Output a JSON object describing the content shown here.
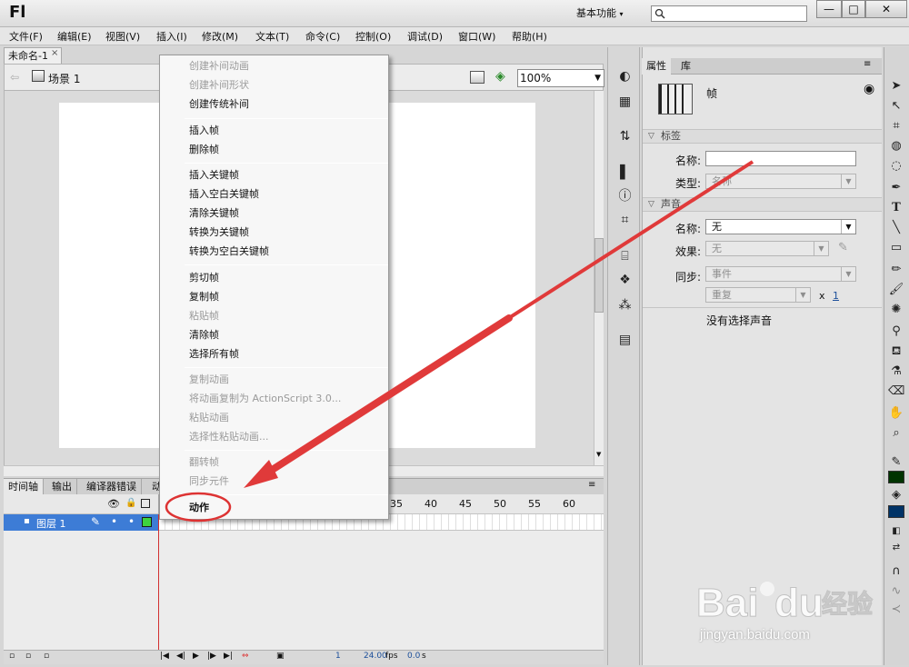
{
  "app": {
    "logo": "Fl",
    "workspace": "基本功能",
    "search_placeholder": ""
  },
  "window_controls": {
    "minimize": "—",
    "maximize": "□",
    "close": "✕"
  },
  "menubar": [
    "文件(F)",
    "编辑(E)",
    "视图(V)",
    "插入(I)",
    "修改(M)",
    "文本(T)",
    "命令(C)",
    "控制(O)",
    "调试(D)",
    "窗口(W)",
    "帮助(H)"
  ],
  "document": {
    "tab": "未命名-1",
    "tab_close": "×",
    "scene": "场景 1",
    "zoom": "100%"
  },
  "context_menu": {
    "items": [
      {
        "label": "创建补间动画",
        "enabled": false
      },
      {
        "label": "创建补间形状",
        "enabled": false
      },
      {
        "label": "创建传统补间",
        "enabled": true
      },
      {
        "label": "插入帧",
        "enabled": true
      },
      {
        "label": "删除帧",
        "enabled": true
      },
      {
        "label": "插入关键帧",
        "enabled": true
      },
      {
        "label": "插入空白关键帧",
        "enabled": true
      },
      {
        "label": "清除关键帧",
        "enabled": true
      },
      {
        "label": "转换为关键帧",
        "enabled": true
      },
      {
        "label": "转换为空白关键帧",
        "enabled": true
      },
      {
        "label": "剪切帧",
        "enabled": true
      },
      {
        "label": "复制帧",
        "enabled": true
      },
      {
        "label": "粘贴帧",
        "enabled": false
      },
      {
        "label": "清除帧",
        "enabled": true
      },
      {
        "label": "选择所有帧",
        "enabled": true
      },
      {
        "label": "复制动画",
        "enabled": false
      },
      {
        "label": "将动画复制为 ActionScript 3.0...",
        "enabled": false
      },
      {
        "label": "粘贴动画",
        "enabled": false
      },
      {
        "label": "选择性粘贴动画...",
        "enabled": false
      },
      {
        "label": "翻转帧",
        "enabled": false
      },
      {
        "label": "同步元件",
        "enabled": false
      },
      {
        "label": "动作",
        "enabled": true,
        "highlighted": true
      }
    ]
  },
  "timeline": {
    "tabs": [
      "时间轴",
      "输出",
      "编译器错误",
      "动"
    ],
    "frame_numbers": [
      "35",
      "40",
      "45",
      "50",
      "55",
      "60"
    ],
    "layer_name": "图层 1",
    "current_frame": "1",
    "fps": "24.00",
    "fps_unit": "fps",
    "time": "0.0",
    "time_unit": "s"
  },
  "properties": {
    "tabs": [
      "属性",
      "库"
    ],
    "title": "帧",
    "label_section": "标签",
    "name_label": "名称:",
    "name_value": "",
    "type_label": "类型:",
    "type_value": "名称",
    "sound_section": "声音",
    "sound_name_label": "名称:",
    "sound_name_value": "无",
    "effect_label": "效果:",
    "effect_value": "无",
    "sync_label": "同步:",
    "sync_value": "事件",
    "repeat_value": "重复",
    "repeat_x": "x",
    "repeat_count": "1",
    "no_sound": "没有选择声音"
  },
  "watermark": {
    "brand": "Bai",
    "brand2": "du",
    "cn": "经验",
    "url": "jingyan.baidu.com"
  },
  "colors": {
    "arrow": "#e03a3a",
    "highlight_circle": "#d33",
    "layer_row": "#3d7cd6",
    "stroke": "#003300",
    "fill": "#003366"
  }
}
